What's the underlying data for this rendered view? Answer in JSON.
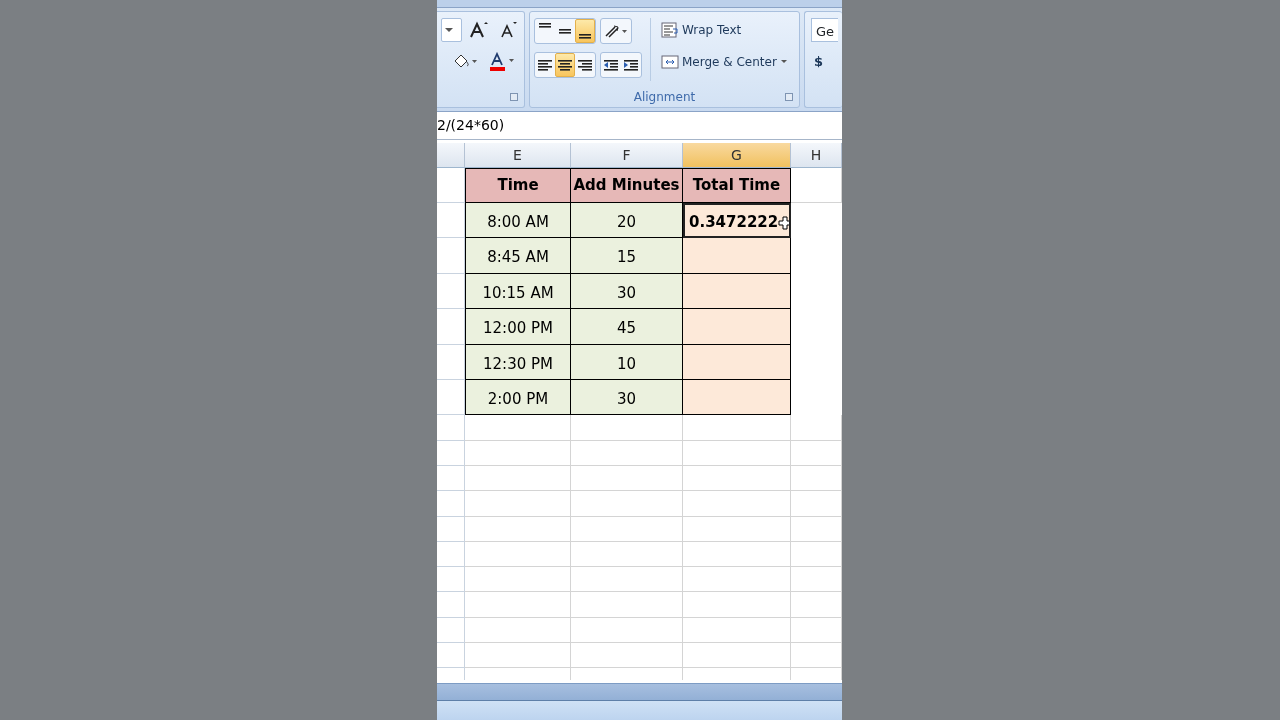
{
  "ribbon": {
    "font_group": {
      "buttons": [
        {
          "kind": "dropdown"
        },
        {
          "kind": "grow"
        },
        {
          "kind": "shrink"
        },
        {
          "kind": "fill"
        },
        {
          "kind": "fontcolor"
        }
      ]
    },
    "alignment_group": {
      "label": "Alignment",
      "vertical": [
        {
          "kind": "top",
          "selected": false
        },
        {
          "kind": "middle",
          "selected": false
        },
        {
          "kind": "bottom",
          "selected": true
        }
      ],
      "horizontal": [
        {
          "kind": "left",
          "selected": false
        },
        {
          "kind": "center",
          "selected": true
        },
        {
          "kind": "right",
          "selected": false
        }
      ],
      "wrap_text": "Wrap Text",
      "merge_center": "Merge & Center"
    },
    "number_group": {
      "format": "Ge",
      "currency": "$"
    }
  },
  "formula_bar": {
    "formula": "2/(24*60)"
  },
  "sheet": {
    "columns": [
      {
        "letter": "E",
        "selected": false
      },
      {
        "letter": "F",
        "selected": false
      },
      {
        "letter": "G",
        "selected": true
      },
      {
        "letter": "H",
        "selected": false
      }
    ],
    "header": [
      "Time",
      "Add Minutes",
      "Total Time"
    ],
    "rows": [
      {
        "cells": [
          "8:00 AM",
          "20",
          "0.3472222"
        ],
        "selected": true
      },
      {
        "cells": [
          "8:45 AM",
          "15",
          ""
        ],
        "selected": false
      },
      {
        "cells": [
          "10:15 AM",
          "30",
          ""
        ],
        "selected": false
      },
      {
        "cells": [
          "12:00 PM",
          "45",
          ""
        ],
        "selected": false
      },
      {
        "cells": [
          "12:30 PM",
          "10",
          ""
        ],
        "selected": false
      },
      {
        "cells": [
          "2:00 PM",
          "30",
          ""
        ],
        "selected": false
      }
    ]
  }
}
